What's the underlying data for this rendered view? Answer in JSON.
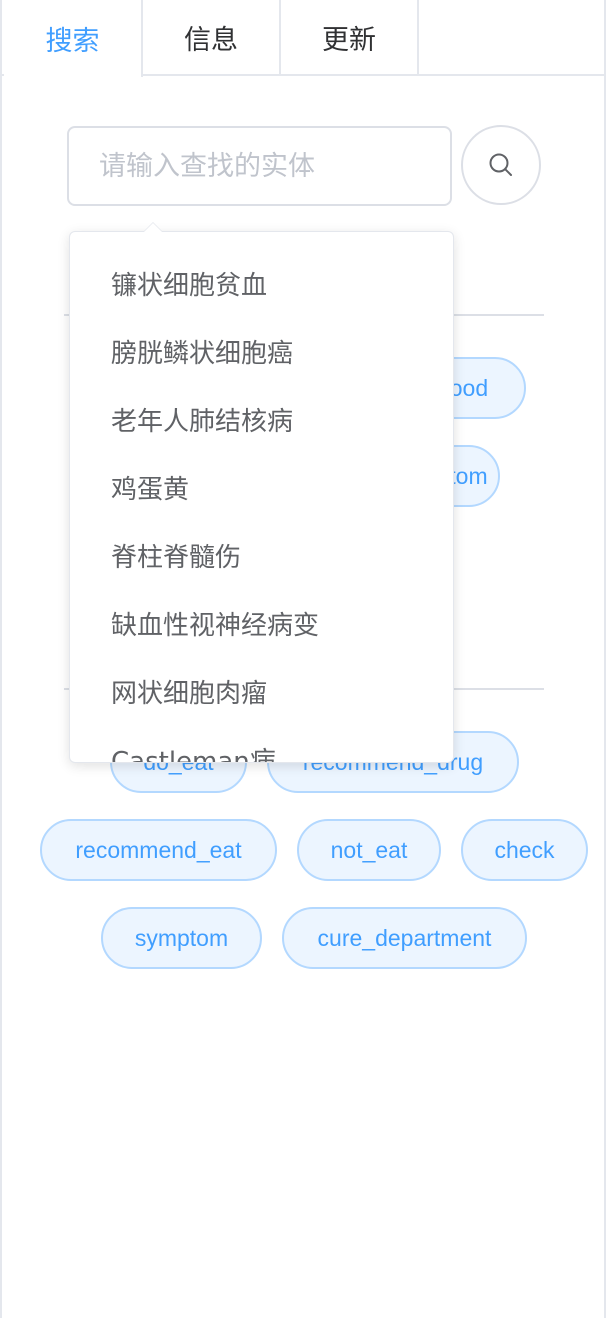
{
  "tabs": [
    {
      "label": "搜索",
      "active": true
    },
    {
      "label": "信息",
      "active": false
    },
    {
      "label": "更新",
      "active": false
    }
  ],
  "search": {
    "placeholder": "请输入查找的实体",
    "value": "",
    "button_icon": "search-icon"
  },
  "section_one": {
    "title": "",
    "tags": [
      "blood",
      "symptom"
    ]
  },
  "section_two": {
    "title": "",
    "tags": [
      "do_eat",
      "recommend_drug",
      "recommend_eat",
      "not_eat",
      "check",
      "symptom",
      "cure_department"
    ]
  },
  "dropdown": {
    "items": [
      "镰状细胞贫血",
      "膀胱鳞状细胞癌",
      "老年人肺结核病",
      "鸡蛋黄",
      "脊柱脊髓伤",
      "缺血性视神经病变",
      "网状细胞肉瘤",
      "Castleman病"
    ]
  },
  "colors": {
    "accent": "#409eff",
    "tag_background": "#ecf5ff",
    "tag_border": "#b3d8ff",
    "text": "#606266",
    "border": "#dcdfe6"
  }
}
